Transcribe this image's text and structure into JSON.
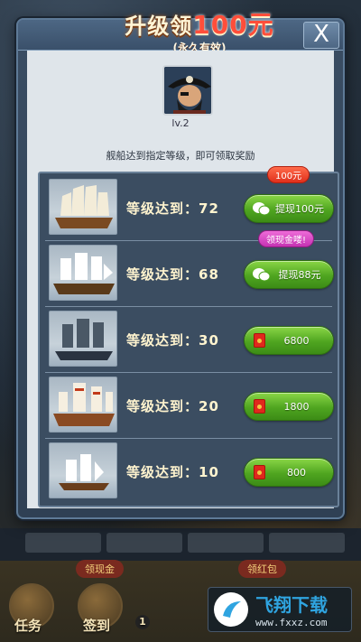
{
  "background": {
    "badges": [
      "领现金",
      "领红包"
    ],
    "bottom_buttons": [
      "任务",
      "签到"
    ],
    "level_num": "1"
  },
  "modal": {
    "title_prefix": "升级领",
    "title_amount": "100元",
    "subtitle": "(永久有效)",
    "close_label": "X",
    "level": "lv.2",
    "hint": "舰船达到指定等级，即可领取奖励",
    "rows": [
      {
        "label": "等级达到：72",
        "button": "提现100元",
        "icon": "wechat-icon",
        "tag": "100元",
        "tag_color": "#e0301c"
      },
      {
        "label": "等级达到：68",
        "button": "提现88元",
        "icon": "wechat-icon",
        "tag": "领现金喽!",
        "tag_color": "#c532b3"
      },
      {
        "label": "等级达到：30",
        "button": "6800",
        "icon": "red-envelope-icon",
        "tag": ""
      },
      {
        "label": "等级达到：20",
        "button": "1800",
        "icon": "red-envelope-icon",
        "tag": ""
      },
      {
        "label": "等级达到：10",
        "button": "800",
        "icon": "red-envelope-icon",
        "tag": ""
      }
    ]
  },
  "watermark": {
    "brand": "飞翔下载",
    "url": "www.fxxz.com"
  },
  "colors": {
    "button_green": "#4fa520",
    "title_red": "#ff4e3a",
    "panel_blue": "#3b4d61"
  }
}
